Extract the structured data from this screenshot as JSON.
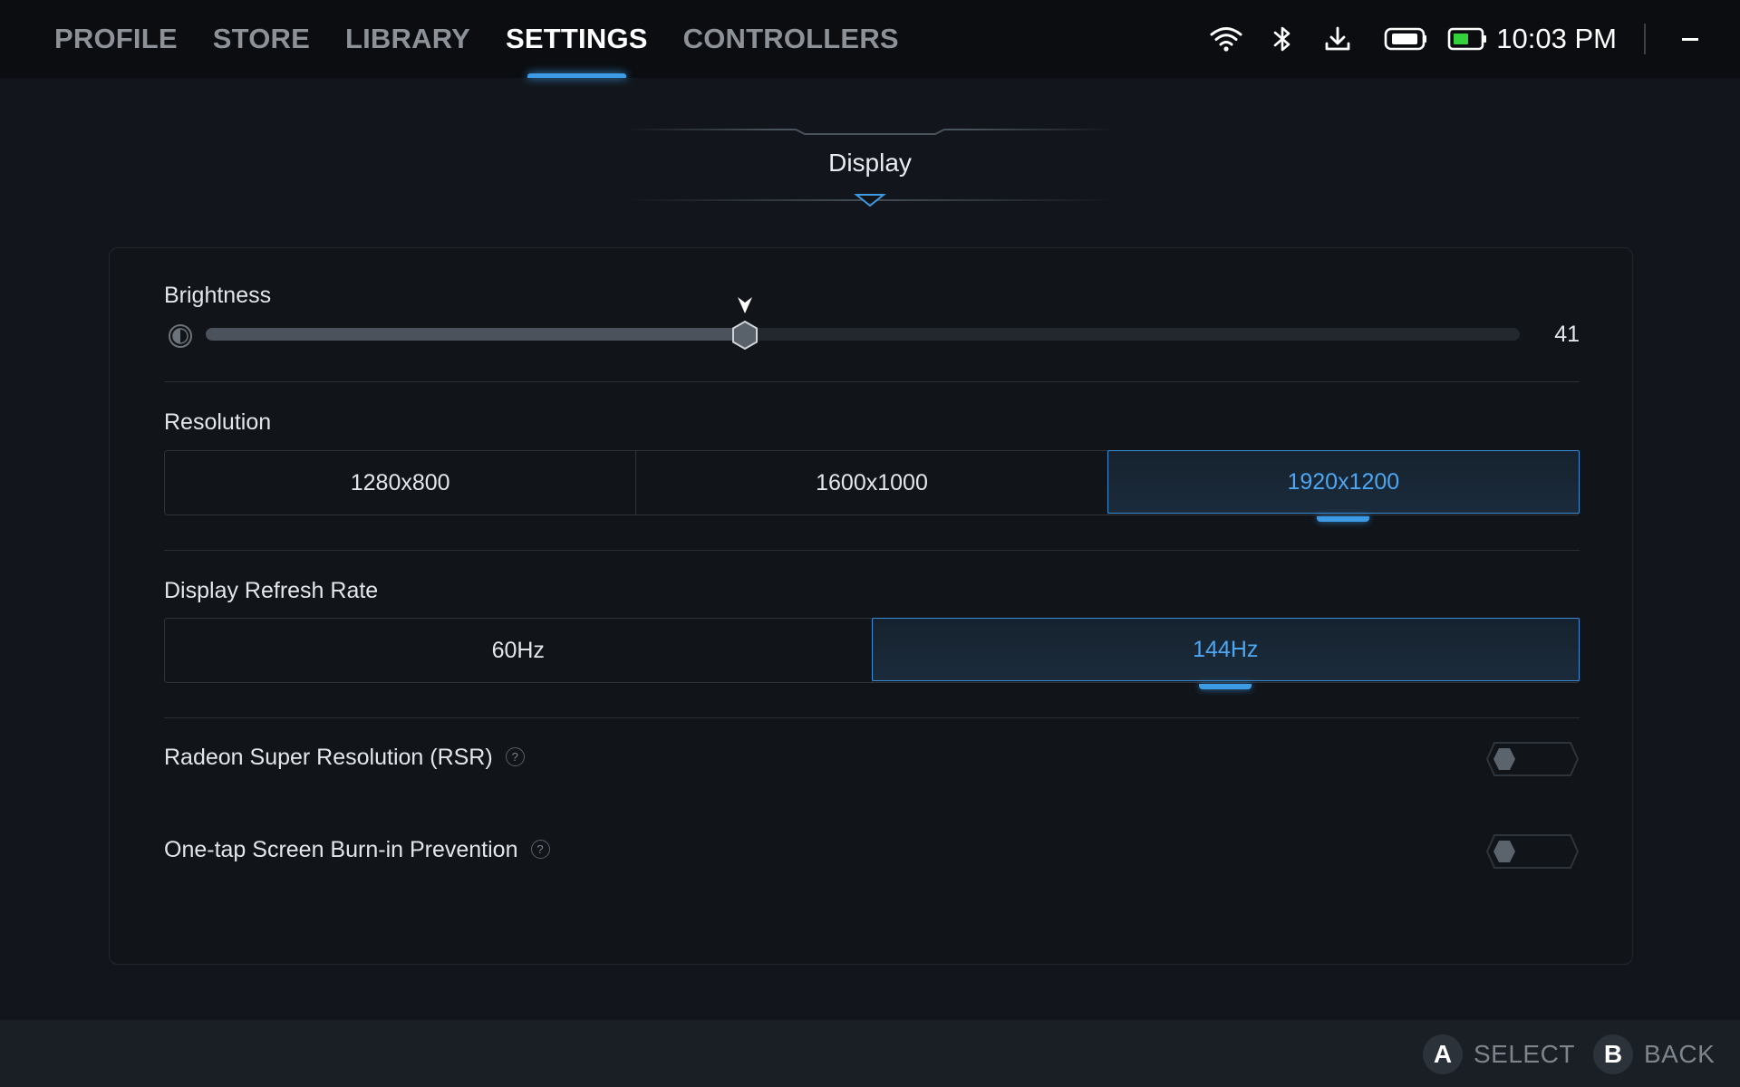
{
  "nav": {
    "tabs": [
      {
        "label": "PROFILE"
      },
      {
        "label": "STORE"
      },
      {
        "label": "LIBRARY"
      },
      {
        "label": "SETTINGS"
      },
      {
        "label": "CONTROLLERS"
      }
    ],
    "active_tab": "SETTINGS"
  },
  "status": {
    "icons": [
      "wifi-icon",
      "bluetooth-icon",
      "download-icon",
      "controller-battery-icon",
      "battery-icon"
    ],
    "time": "10:03 PM"
  },
  "section": {
    "title": "Display"
  },
  "brightness": {
    "label": "Brightness",
    "value": 41,
    "display_value": "41"
  },
  "resolution": {
    "label": "Resolution",
    "options": [
      "1280x800",
      "1600x1000",
      "1920x1200"
    ],
    "selected": "1920x1200"
  },
  "refresh_rate": {
    "label": "Display Refresh Rate",
    "options": [
      "60Hz",
      "144Hz"
    ],
    "selected": "144Hz"
  },
  "rsr": {
    "label": "Radeon Super Resolution (RSR)",
    "help": "?",
    "enabled": false
  },
  "burn_in": {
    "label": "One-tap Screen Burn-in Prevention",
    "help": "?",
    "enabled": false
  },
  "footer": {
    "select_button": "A",
    "select_label": "SELECT",
    "back_button": "B",
    "back_label": "BACK"
  },
  "colors": {
    "accent": "#3d9be6",
    "background": "#12161c",
    "battery_green": "#34d23a"
  }
}
